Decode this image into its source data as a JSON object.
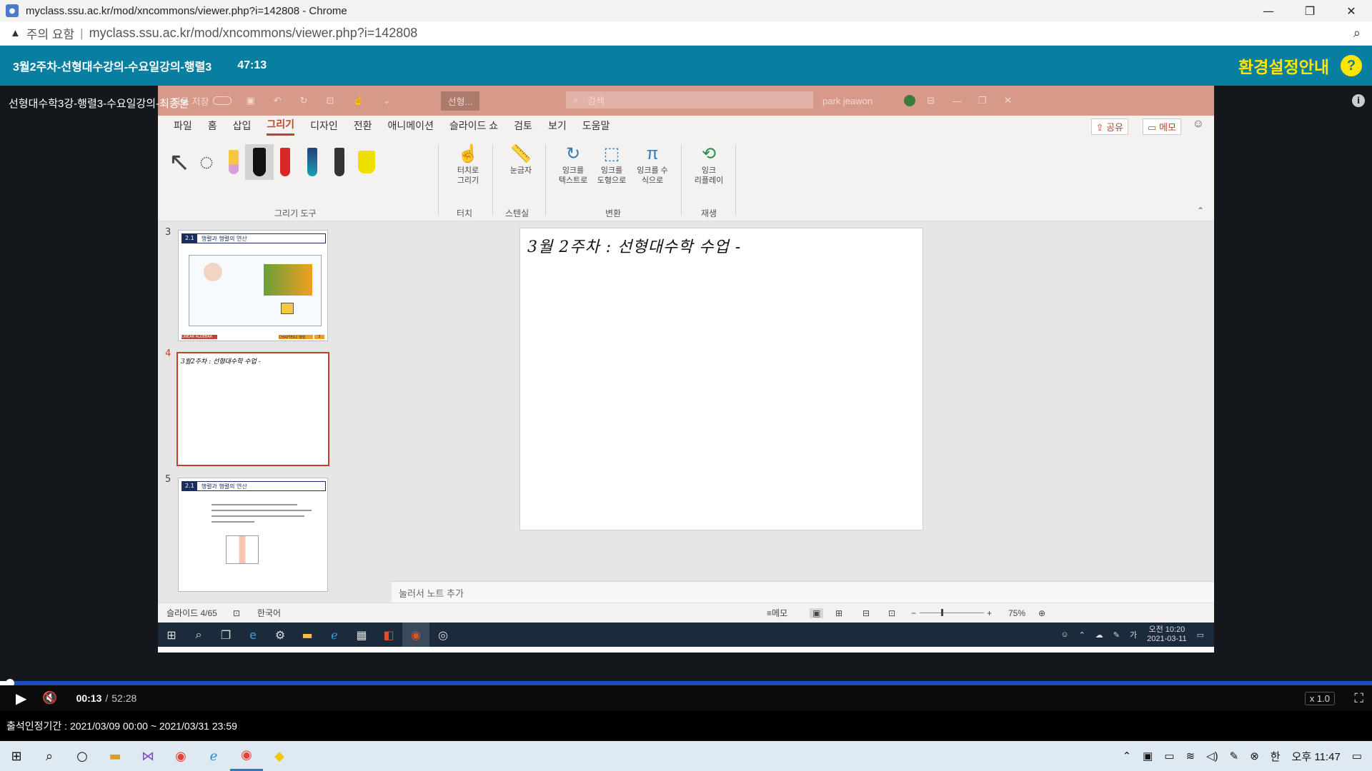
{
  "chrome": {
    "window_title": "myclass.ssu.ac.kr/mod/xncommons/viewer.php?i=142808 - Chrome",
    "warning": "주의 요함",
    "separator": "|",
    "url": "myclass.ssu.ac.kr/mod/xncommons/viewer.php?i=142808",
    "controls": {
      "minimize": "—",
      "restore": "❐",
      "close": "✕"
    }
  },
  "course": {
    "title": "3월2주차-선형대수강의-수요일강의-행렬3",
    "duration": "47:13",
    "settings_link": "환경설정안내",
    "help_label": "?"
  },
  "video": {
    "title": "선형대수학3강-행렬3-수요일강의-최종본",
    "info_icon_label": "i"
  },
  "ppt": {
    "titlebar": {
      "autosave": "자동 저장",
      "doc_name": "선형...",
      "search_placeholder": "검색",
      "user": "park jeawon"
    },
    "tabs": [
      "파일",
      "홈",
      "삽입",
      "그리기",
      "디자인",
      "전환",
      "애니메이션",
      "슬라이드 쇼",
      "검토",
      "보기",
      "도움말"
    ],
    "active_tab": "그리기",
    "share_label": "공유",
    "memo_label": "메모",
    "ribbon": {
      "groups": [
        "그리기 도구",
        "터치",
        "스텐실",
        "변환",
        "재생"
      ],
      "touch_btn": "터치로\n그리기",
      "ruler_btn": "눈금자",
      "ink_text_btn": "잉크를\n텍스트로",
      "ink_shape_btn": "잉크를\n도형으로",
      "ink_math_btn": "잉크를 수\n식으로",
      "ink_replay_btn": "잉크\n리플레이",
      "pen_colors": [
        "#f5c842",
        "#111111",
        "#d92626",
        "#1f6fb2",
        "#1a1a1a",
        "#f0e000"
      ]
    },
    "thumbnails": [
      {
        "num": "3",
        "badge": "2.1",
        "heading": "행렬과 행렬의 연산",
        "footer_left": "LINEAR ALGEBRA",
        "footer_right": "CHAPTER2 행렬",
        "page": "3"
      },
      {
        "num": "4",
        "handwriting": "3월2주차 : 선형대수학 수업 -"
      },
      {
        "num": "5",
        "badge": "2.1",
        "heading": "행렬과 행렬의 연산"
      }
    ],
    "slide_handwriting": "3월 2주차 : 선형대수학 수업 -",
    "notes_placeholder": "눌러서 노트 추가",
    "status": {
      "slide_counter": "슬라이드 4/65",
      "language": "한국어",
      "memo": "메모",
      "zoom": "75%"
    },
    "inner_taskbar": {
      "clock_line1": "오전 10:20",
      "clock_line2": "2021-03-11",
      "ime": "가"
    }
  },
  "player": {
    "current_time": "00:13",
    "total_time": "52:28",
    "separator": "/",
    "speed": "x 1.0",
    "progress_fraction": 0.004
  },
  "attendance": "출석인정기간 : 2021/03/09 00:00 ~ 2021/03/31 23:59",
  "taskbar": {
    "ime_lang": "한",
    "clock": "오후 11:47"
  },
  "colors": {
    "course_header": "#087ea0",
    "settings_link": "#ffe600",
    "ppt_accent": "#b7472a",
    "progress": "#1a4fb5"
  }
}
